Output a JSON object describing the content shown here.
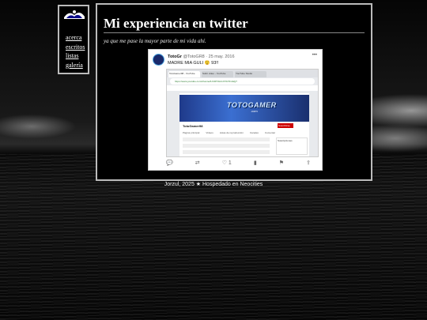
{
  "nav": {
    "items": [
      {
        "label": "acerca"
      },
      {
        "label": "escritos"
      },
      {
        "label": "listas"
      },
      {
        "label": "galería"
      }
    ]
  },
  "post": {
    "title": "Mi experiencia en twitter",
    "subtitle": "ya que me pase la mayor parte de mi vida ahí."
  },
  "tweet": {
    "display_name": "TotoGr",
    "handle_date": "@TotoGR8 · 25 may. 2016",
    "text": "MADRE MIA GULI 😲 93!!",
    "more_icon": "more-horizontal-icon",
    "screenshot": {
      "tabs": [
        "TotoGamer98 - YouTube",
        "Subir video - YouTube",
        "YouTube Studio"
      ],
      "url": "https://www.youtube.com/channel/UCRTOkJnIYhN7FuWgT",
      "banner_title": "TOTOGAMER",
      "banner_sub": ".com",
      "channel_name": "TotoGamer98",
      "subscribe_label": "Suscribirse",
      "channel_tabs": [
        "Página principal",
        "Vídeos",
        "Listas de reproducción",
        "Canales",
        "Comentar"
      ],
      "side_title": "Suscripciones"
    },
    "actions": {
      "reply_icon": "reply-icon",
      "retweet_icon": "retweet-icon",
      "like_icon": "heart-icon",
      "like_count": "1",
      "analytics_icon": "analytics-icon",
      "bookmark_icon": "bookmark-icon",
      "share_icon": "share-icon"
    }
  },
  "footer": {
    "text": "Jorzul, 2025 ★ Hospedado en Neocities"
  }
}
